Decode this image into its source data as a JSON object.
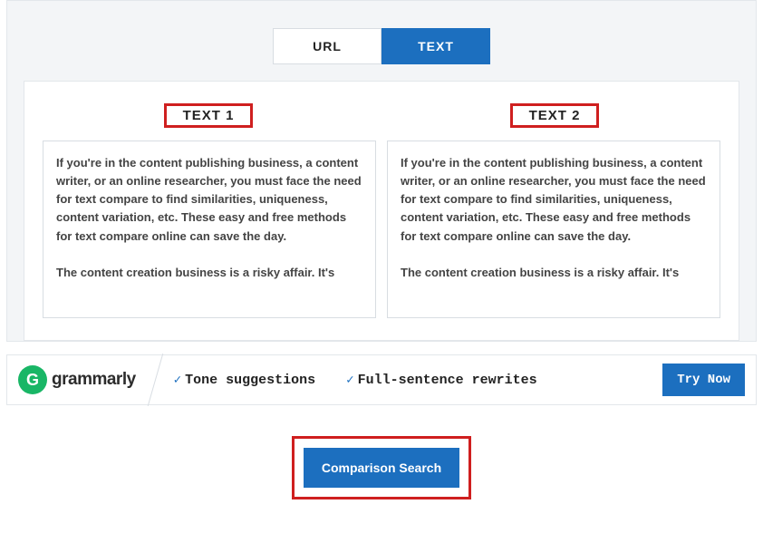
{
  "tabs": {
    "url": "URL",
    "text": "TEXT"
  },
  "headers": {
    "text1": "TEXT 1",
    "text2": "TEXT 2"
  },
  "textareas": {
    "text1": "If you're in the content publishing business, a content writer, or an online researcher, you must face the need for text compare to find similarities, uniqueness, content variation, etc. These easy and free methods for text compare online can save the day.\n\nThe content creation business is a risky affair. It's",
    "text2": "If you're in the content publishing business, a content writer, or an online researcher, you must face the need for text compare to find similarities, uniqueness, content variation, etc. These easy and free methods for text compare online can save the day.\n\nThe content creation business is a risky affair. It's"
  },
  "ad": {
    "logo_letter": "G",
    "logo_text": "grammarly",
    "feature1": "Tone suggestions",
    "feature2": "Full-sentence rewrites",
    "cta": "Try Now"
  },
  "action": {
    "button": "Comparison Search"
  }
}
